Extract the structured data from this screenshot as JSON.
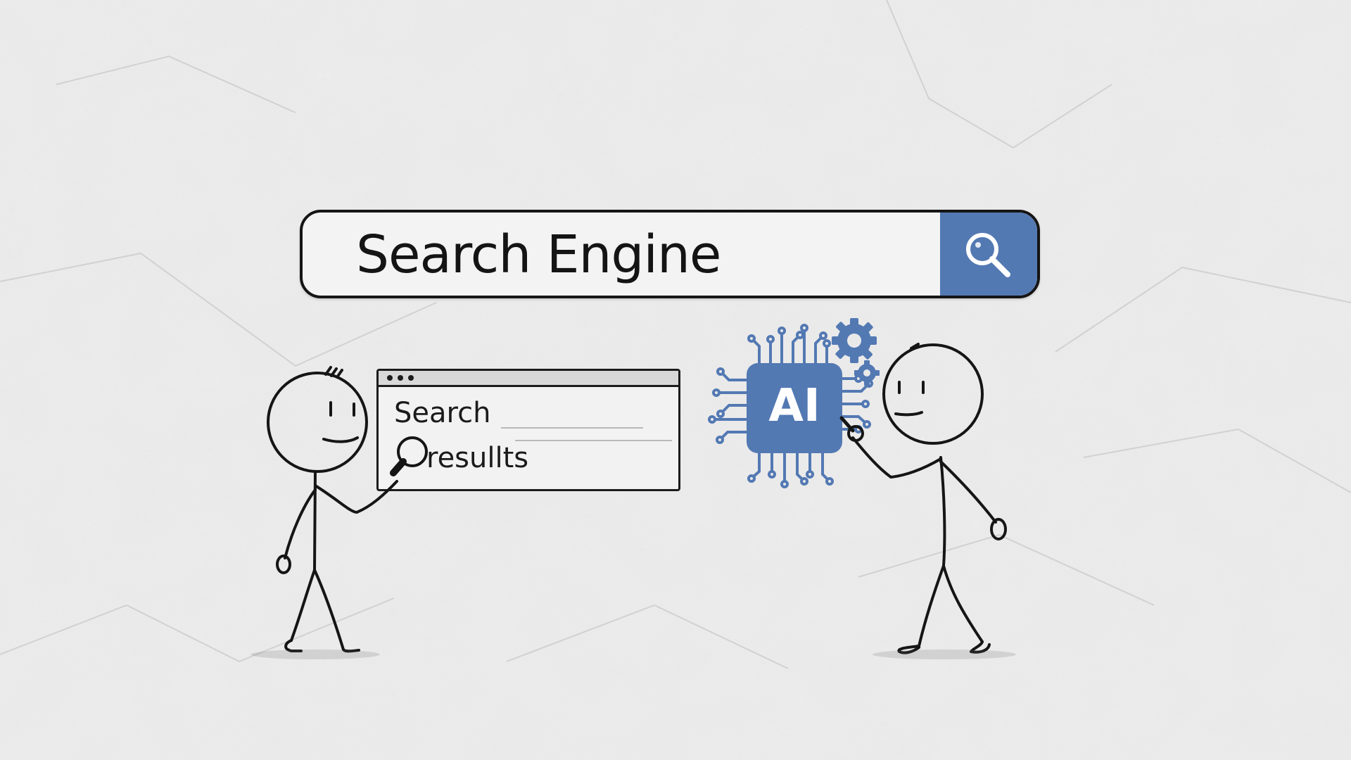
{
  "search_bar": {
    "text": "Search Engine",
    "button_icon": "search-icon"
  },
  "browser_window": {
    "title": "Search",
    "subtitle": "resullts"
  },
  "ai_chip": {
    "label": "AI"
  },
  "colors": {
    "background": "#e9e9e9",
    "accent": "#5379b3",
    "ink": "#151515"
  }
}
